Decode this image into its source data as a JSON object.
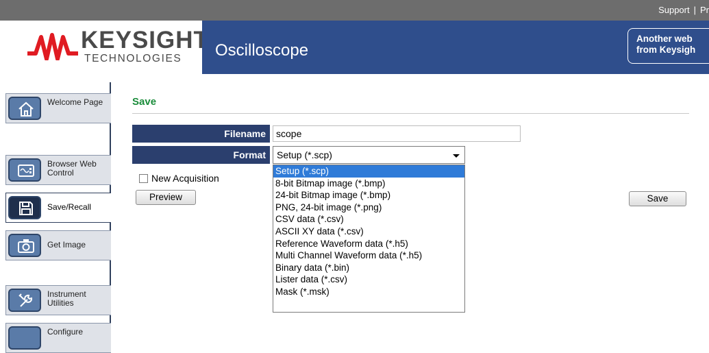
{
  "top_links": {
    "support": "Support",
    "separator": "|",
    "next": "Pr"
  },
  "logo": {
    "word": "KEYSIGHT",
    "sub": "TECHNOLOGIES"
  },
  "banner": {
    "title": "Oscilloscope",
    "button_line1": "Another web",
    "button_line2": "from Keysigh"
  },
  "sidebar": {
    "items": [
      {
        "label": "Welcome Page",
        "icon": "home-icon"
      },
      {
        "label": "Browser Web Control",
        "icon": "browser-control-icon"
      },
      {
        "label": "Save/Recall",
        "icon": "floppy-disk-icon"
      },
      {
        "label": "Get Image",
        "icon": "camera-icon"
      },
      {
        "label": "Instrument Utilities",
        "icon": "tools-icon"
      },
      {
        "label": "Configure",
        "icon": "configure-icon"
      }
    ]
  },
  "main": {
    "title": "Save",
    "filename_label": "Filename",
    "filename_value": "scope",
    "format_label": "Format",
    "format_selected": "Setup (*.scp)",
    "format_options": [
      "Setup (*.scp)",
      "8-bit Bitmap image (*.bmp)",
      "24-bit Bitmap image (*.bmp)",
      "PNG, 24-bit image (*.png)",
      "CSV data (*.csv)",
      "ASCII XY data (*.csv)",
      "Reference Waveform data (*.h5)",
      "Multi Channel Waveform data (*.h5)",
      "Binary data (*.bin)",
      "Lister data (*.csv)",
      "Mask (*.msk)"
    ],
    "new_acquisition_label": "New Acquisition",
    "preview_label": "Preview",
    "save_label": "Save"
  },
  "colors": {
    "banner": "#2f4e8c",
    "brand_red": "#e01b22",
    "title_green": "#1a8c3a",
    "selection": "#2f7bd8"
  }
}
